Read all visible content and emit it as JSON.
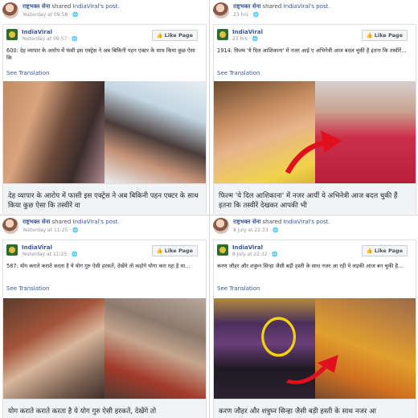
{
  "posts": [
    {
      "sharer": "राष्ट्रभक्त सेना",
      "shared_text": "shared",
      "shared_page": "IndiaViral's post.",
      "sharer_time": "Yesterday at 09:58 · 🌐",
      "page": "IndiaViral",
      "page_time": "Yesterday at 09:57 · 🌐",
      "like_label": "Like Page",
      "text": "600: देह व्यापार के आरोप में फंसी इस एक्ट्रेस ने अब बिकिनी पहन एक्टर के साथ किया कुछ ऐसा कि",
      "see_translation": "See Translation",
      "caption": "देह व्यापार के आरोप में फासी इस एक्ट्रेस ने अब बिकिनी पहन एक्टर के साथ किया कुछ ऐसा कि तस्वीरें वा"
    },
    {
      "sharer": "राष्ट्रभक्त सेना",
      "shared_text": "shared",
      "shared_page": "IndiaViral's post.",
      "sharer_time": "23 hrs · 🌐",
      "page": "IndiaViral",
      "page_time": "23 hrs · 🌐",
      "like_label": "Like Page",
      "text": "1914: फ़िल्म 'ये दिल आशिकाना' में नजर आई ए अभिनेत्री आज बदल चुकी है इतना कि तस्वीरें...",
      "see_translation": "See Translation",
      "caption": "फिल्म 'ये दिल आशिकाना' में नजर आयीं ये अभिनेत्री आज बदल चुकी हैं इतना कि तस्वीरें देखकर आपकी भी"
    },
    {
      "sharer": "राष्ट्रभक्त सेना",
      "shared_text": "shared",
      "shared_page": "IndiaViral's post.",
      "sharer_time": "Yesterday at 11:25 · 🌐",
      "page": "IndiaViral",
      "page_time": "Yesterday at 11:25 · 🌐",
      "like_label": "Like Page",
      "text": "587: योग कराते कराते करता है ये योग गुरु ऐसी हरकतें, देखेंगे तो कहोगे योगा करा रहा है या...",
      "see_translation": "See Translation",
      "caption": "योग कराते कराते करता है ये योग गुरु ऐसी हरकतें, देखेंगे तो"
    },
    {
      "sharer": "राष्ट्रभक्त सेना",
      "shared_text": "shared",
      "shared_page": "IndiaViral's post.",
      "sharer_time": "8 July at 22:33 · 🌐",
      "page": "IndiaViral",
      "page_time": "8 July at 22:32 · 🌐",
      "like_label": "Like Page",
      "text": "करण जौहर और शत्रुघ्न सिन्हा जैसी बड़ी हस्ती के साथ नजर आ रही ये लड़की आज बन चुकी है...",
      "see_translation": "See Translation",
      "caption": "करण जौहर और शत्रुघ्न सिन्हा जैसी बड़ी हस्ती के साथ नजर आ"
    }
  ]
}
